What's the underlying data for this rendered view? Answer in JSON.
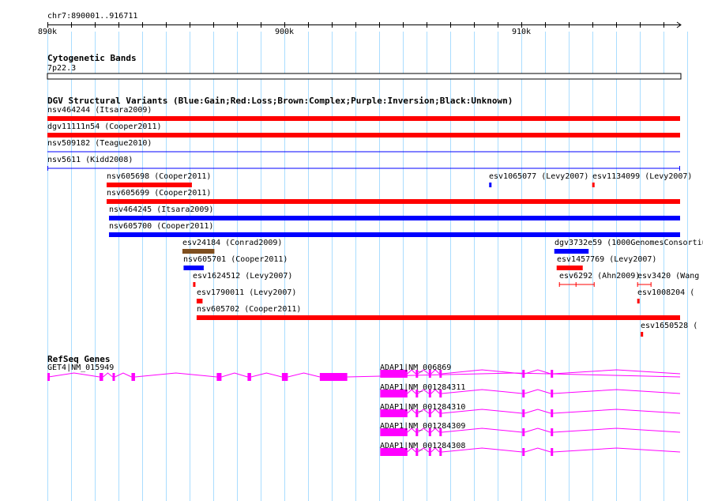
{
  "region": {
    "label": "chr7:890001..916711",
    "start": 890000,
    "end": 916711
  },
  "ruler": {
    "ticks": [
      {
        "pos": 890000,
        "label": "890k"
      },
      {
        "pos": 900000,
        "label": "900k"
      },
      {
        "pos": 910000,
        "label": "910k"
      }
    ]
  },
  "tracks": {
    "cytoband": {
      "title": "Cytogenetic Bands",
      "band": "7p22.3"
    },
    "dgv": {
      "title": "DGV Structural Variants (Blue:Gain;Red:Loss;Brown:Complex;Purple:Inversion;Black:Unknown)"
    },
    "refseq": {
      "title": "RefSeq Genes"
    }
  },
  "colors": {
    "gain": "#0000ff",
    "loss": "#ff0000",
    "complex": "#7f4f1f",
    "line_blue": "#0000ff",
    "gene": "#ff00ff",
    "grid": "#aaddff"
  },
  "variants": [
    {
      "label": "nsv464244 (Itsara2009)",
      "start": 890000,
      "end": 916711,
      "type": "loss",
      "style": "bar"
    },
    {
      "label": "dgv11111n54 (Cooper2011)",
      "start": 890000,
      "end": 916711,
      "type": "loss",
      "style": "bar"
    },
    {
      "label": "nsv509182 (Teague2010)",
      "start": 890000,
      "end": 916711,
      "type": "gain",
      "style": "line"
    },
    {
      "label": "nsv5611 (Kidd2008)",
      "start": 890000,
      "end": 916711,
      "type": "gain",
      "style": "capped"
    },
    {
      "label": "nsv605698 (Cooper2011)",
      "start": 892500,
      "end": 896100,
      "type": "loss",
      "style": "bar"
    },
    {
      "label": "esv1065077 (Levy2007)",
      "start": 908650,
      "end": 908700,
      "type": "gain",
      "style": "bar"
    },
    {
      "label": "esv1134099 (Levy2007)",
      "start": 913000,
      "end": 913100,
      "type": "loss",
      "style": "bar"
    },
    {
      "label": "nsv605699 (Cooper2011)",
      "start": 892500,
      "end": 916711,
      "type": "loss",
      "style": "bar"
    },
    {
      "label": "nsv464245 (Itsara2009)",
      "start": 892600,
      "end": 916711,
      "type": "gain",
      "style": "bar"
    },
    {
      "label": "nsv605700 (Cooper2011)",
      "start": 892600,
      "end": 916711,
      "type": "gain",
      "style": "bar"
    },
    {
      "label": "esv24184 (Conrad2009)",
      "start": 895700,
      "end": 897050,
      "type": "complex",
      "style": "bar"
    },
    {
      "label": "dgv3732e59 (1000GenomesConsortiu",
      "start": 911400,
      "end": 912850,
      "type": "gain",
      "style": "bar"
    },
    {
      "label": "nsv605701 (Cooper2011)",
      "start": 895750,
      "end": 896600,
      "type": "gain",
      "style": "bar"
    },
    {
      "label": "esv1457769 (Levy2007)",
      "start": 911500,
      "end": 912600,
      "type": "loss",
      "style": "bar"
    },
    {
      "label": "esv1624512 (Levy2007)",
      "start": 896150,
      "end": 896250,
      "type": "loss",
      "style": "bar"
    },
    {
      "label": "esv6292 (Ahn2009)",
      "start": 911600,
      "end": 913100,
      "type": "loss",
      "style": "capped"
    },
    {
      "label": "esv3420 (Wang",
      "start": 914900,
      "end": 915500,
      "type": "loss",
      "style": "capped"
    },
    {
      "label": "esv1790011 (Levy2007)",
      "start": 896300,
      "end": 896550,
      "type": "loss",
      "style": "bar"
    },
    {
      "label": "esv1008204 (",
      "start": 914900,
      "end": 915000,
      "type": "loss",
      "style": "bar"
    },
    {
      "label": "nsv605702 (Cooper2011)",
      "start": 896300,
      "end": 916711,
      "type": "loss",
      "style": "bar"
    },
    {
      "label": "esv1650528 (",
      "start": 915050,
      "end": 915150,
      "type": "loss",
      "style": "bar"
    }
  ],
  "genes": [
    {
      "label": "GET4|NM_015949",
      "start": 890000,
      "end": 902660,
      "strand": "+",
      "exons": [
        [
          890000,
          890050
        ],
        [
          892200,
          892350
        ],
        [
          892750,
          892850
        ],
        [
          893550,
          893700
        ],
        [
          897150,
          897350
        ],
        [
          898450,
          898600
        ],
        [
          899900,
          900050
        ],
        [
          900000,
          900150
        ],
        [
          901500,
          902660
        ]
      ]
    },
    {
      "label": "ADAP1|NM_006869",
      "start": 904050,
      "end": 916711,
      "strand": "-",
      "exons": [
        [
          904050,
          905200
        ],
        [
          905550,
          905650
        ],
        [
          906100,
          906200
        ],
        [
          906550,
          906650
        ],
        [
          910050,
          910150
        ],
        [
          911250,
          911350
        ]
      ]
    },
    {
      "label": "ADAP1|NM_001284311",
      "start": 904050,
      "end": 916711,
      "strand": "-",
      "exons": [
        [
          904050,
          905200
        ],
        [
          905550,
          905650
        ],
        [
          906100,
          906200
        ],
        [
          906550,
          906650
        ],
        [
          910050,
          910150
        ],
        [
          911250,
          911350
        ]
      ]
    },
    {
      "label": "ADAP1|NM_001284310",
      "start": 904050,
      "end": 916711,
      "strand": "-",
      "exons": [
        [
          904050,
          905200
        ],
        [
          905550,
          905650
        ],
        [
          906100,
          906200
        ],
        [
          906550,
          906650
        ],
        [
          910050,
          910150
        ],
        [
          911250,
          911350
        ]
      ]
    },
    {
      "label": "ADAP1|NM_001284309",
      "start": 904050,
      "end": 916711,
      "strand": "-",
      "exons": [
        [
          904050,
          905200
        ],
        [
          905550,
          905650
        ],
        [
          906100,
          906200
        ],
        [
          906550,
          906650
        ],
        [
          910050,
          910150
        ],
        [
          911250,
          911350
        ]
      ]
    },
    {
      "label": "ADAP1|NM_001284308",
      "start": 904050,
      "end": 916711,
      "strand": "-",
      "exons": [
        [
          904050,
          905200
        ],
        [
          905550,
          905650
        ],
        [
          906100,
          906200
        ],
        [
          906550,
          906650
        ],
        [
          910050,
          910150
        ],
        [
          911250,
          911350
        ]
      ]
    }
  ]
}
